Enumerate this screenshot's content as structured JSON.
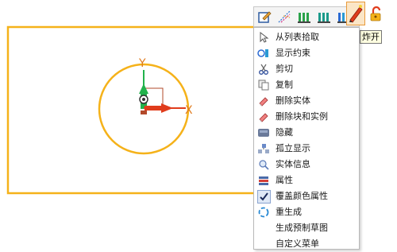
{
  "toolbar": {
    "buttons": [
      {
        "icon": "edit-sketch-icon"
      },
      {
        "icon": "constraint-lines-icon"
      },
      {
        "icon": "dimension-green-icon"
      },
      {
        "icon": "dimension-teal-icon"
      },
      {
        "icon": "dimension-blue-icon"
      },
      {
        "icon": "explode-pencil-icon"
      },
      {
        "icon": "unlock-icon"
      }
    ],
    "tooltip": "炸开"
  },
  "sketch": {
    "x_axis_label": "X",
    "y_axis_label": "Y",
    "colors": {
      "geometry": "#f5b21a",
      "x_axis": "#e03c1c",
      "y_axis": "#22b24c"
    }
  },
  "context_menu": {
    "items": [
      {
        "label": "从列表拾取",
        "icon": "cursor-icon"
      },
      {
        "label": "显示约束",
        "icon": "show-constraints-icon"
      },
      {
        "label": "剪切",
        "icon": "scissors-icon"
      },
      {
        "label": "复制",
        "icon": "copy-icon"
      },
      {
        "label": "删除实体",
        "icon": "eraser-icon"
      },
      {
        "label": "删除块和实例",
        "icon": "eraser-block-icon"
      },
      {
        "label": "隐藏",
        "icon": "hide-icon"
      },
      {
        "label": "孤立显示",
        "icon": "isolate-icon"
      },
      {
        "label": "实体信息",
        "icon": "info-icon"
      },
      {
        "label": "属性",
        "icon": "properties-icon"
      },
      {
        "label": "覆盖颜色属性",
        "icon": "checkmark-icon"
      },
      {
        "label": "重生成",
        "icon": "regenerate-icon"
      },
      {
        "label": "生成预制草图",
        "icon": ""
      },
      {
        "label": "自定义菜单",
        "icon": ""
      }
    ]
  }
}
